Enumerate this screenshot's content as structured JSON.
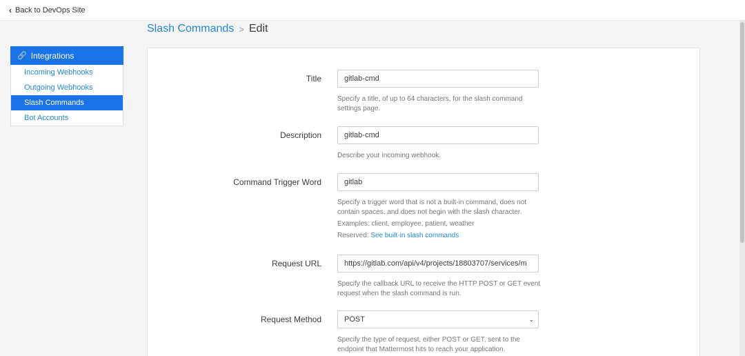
{
  "topbar": {
    "back_label": "Back to DevOps Site"
  },
  "breadcrumb": {
    "parent": "Slash Commands",
    "separator": ">",
    "current": "Edit"
  },
  "sidebar": {
    "header": "Integrations",
    "items": [
      {
        "label": "Incoming Webhooks",
        "active": false
      },
      {
        "label": "Outgoing Webhooks",
        "active": false
      },
      {
        "label": "Slash Commands",
        "active": true
      },
      {
        "label": "Bot Accounts",
        "active": false
      }
    ]
  },
  "form": {
    "title": {
      "label": "Title",
      "value": "gitlab-cmd",
      "help": "Specify a title, of up to 64 characters, for the slash command settings page."
    },
    "description": {
      "label": "Description",
      "value": "gitlab-cmd",
      "help": "Describe your incoming webhook."
    },
    "trigger": {
      "label": "Command Trigger Word",
      "value": "gitlab",
      "help": "Specify a trigger word that is not a built-in command, does not contain spaces, and does not begin with the slash character.",
      "examples": "Examples: client, employee, patient, weather",
      "reserved_prefix": "Reserved: ",
      "reserved_link": "See built-in slash commands"
    },
    "url": {
      "label": "Request URL",
      "value": "https://gitlab.com/api/v4/projects/18803707/services/m",
      "help": "Specify the callback URL to receive the HTTP POST or GET event request when the slash command is run."
    },
    "method": {
      "label": "Request Method",
      "value": "POST",
      "help": "Specify the type of request, either POST or GET, sent to the endpoint that Mattermost hits to reach your application."
    }
  },
  "colors": {
    "accent": "#1a73e8",
    "link": "#2389d7"
  }
}
